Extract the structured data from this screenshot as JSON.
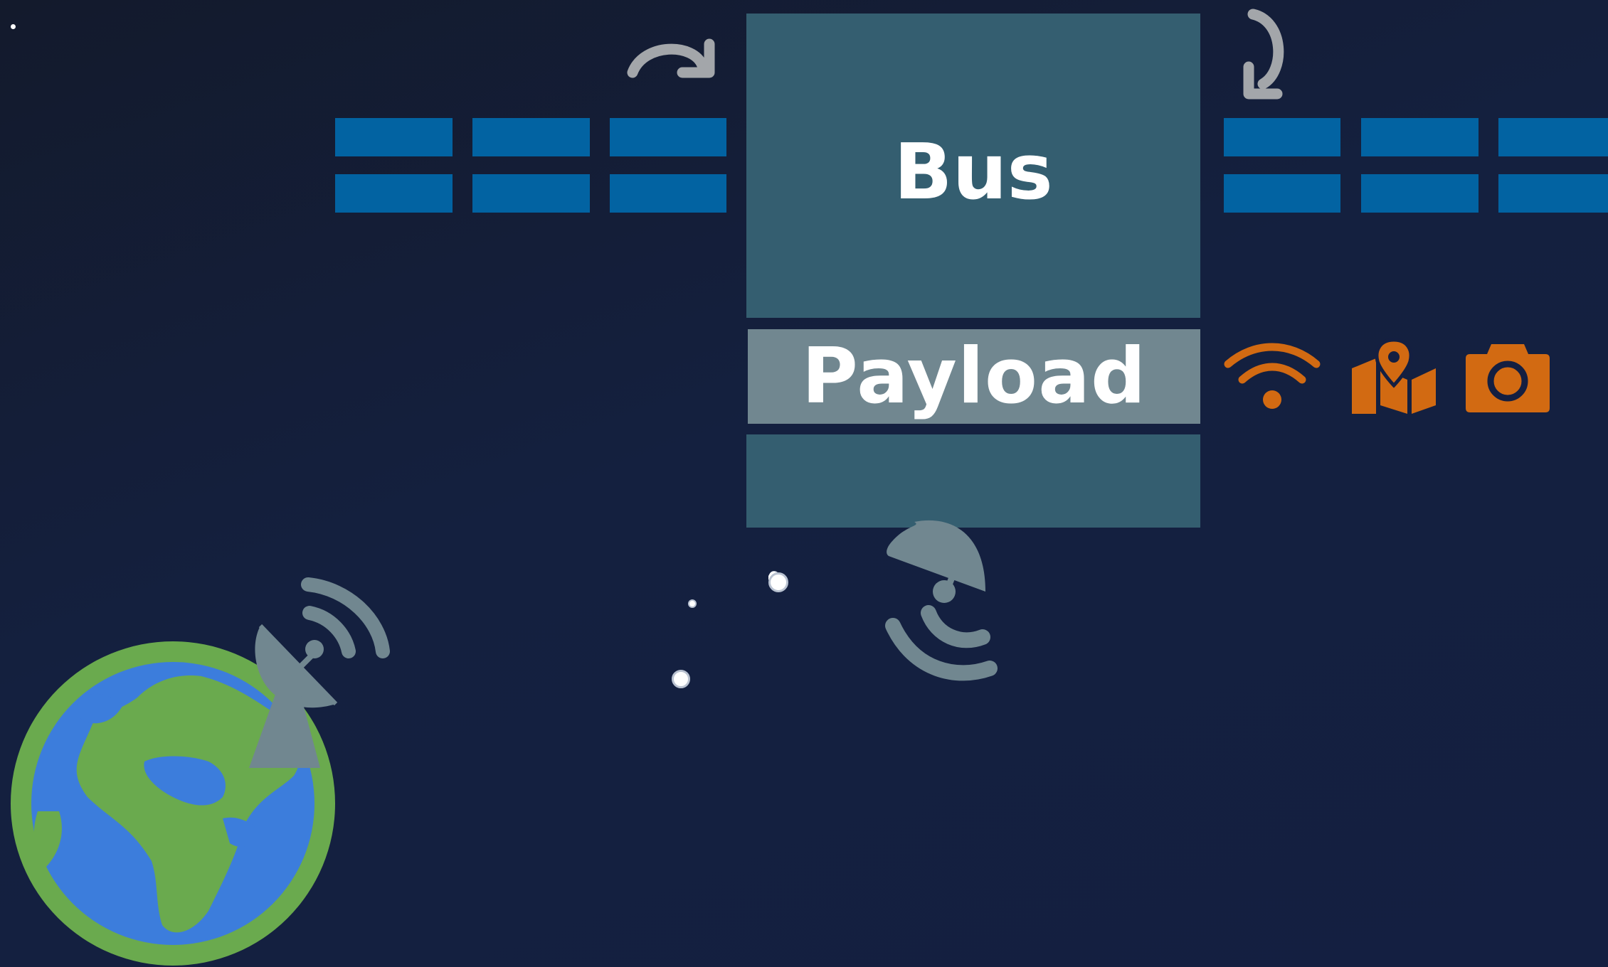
{
  "diagram": {
    "bus_label": "Bus",
    "payload_label": "Payload"
  },
  "icons": [
    "rotate-cw-icon",
    "rotate-cw-down-icon",
    "solar-panel-icon",
    "wifi-icon",
    "map-marker-icon",
    "camera-icon",
    "satellite-dish-icon",
    "earth-icon",
    "ground-station-icon",
    "star-icon"
  ],
  "colors": {
    "background": "#141f41",
    "solar_panel": "#0263a2",
    "bus": "#345e70",
    "payload": "#718790",
    "payload_icon": "#d26a12",
    "rotation_arrow": "#a3a6aa",
    "dish": "#718790",
    "earth_ocean": "#3c7ddc",
    "earth_land": "#6aaa4e"
  }
}
